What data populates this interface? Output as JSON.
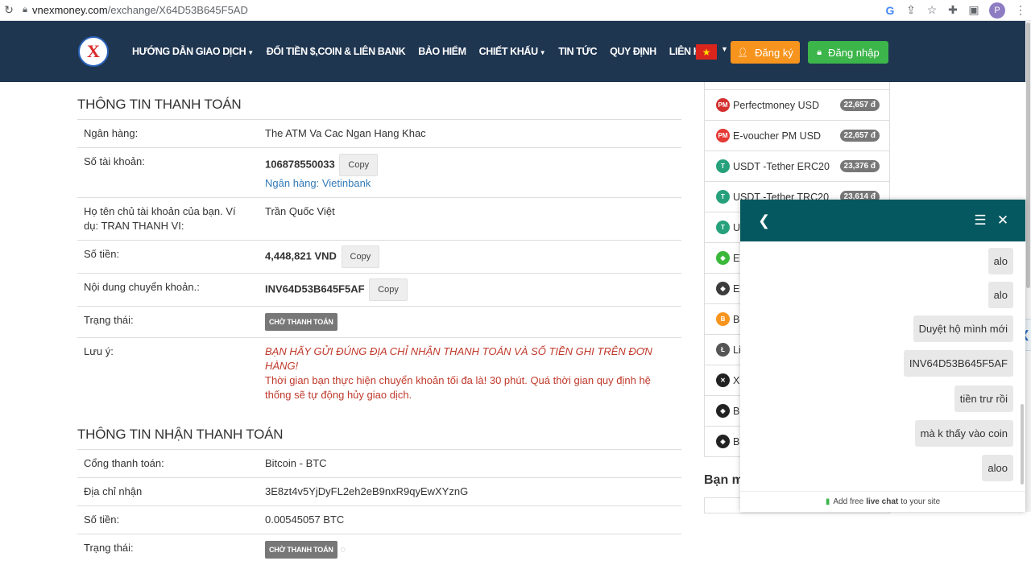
{
  "browser": {
    "url_host": "vnexmoney.com",
    "url_path": "/exchange/X64D53B645F5AD",
    "profile_initial": "P"
  },
  "nav": {
    "items": [
      {
        "label": "HƯỚNG DẪN GIAO DỊCH",
        "has_caret": true
      },
      {
        "label": "ĐỔI TIỀN $,COIN & LIÊN BANK",
        "has_caret": false
      },
      {
        "label": "BẢO HIỂM",
        "has_caret": false
      },
      {
        "label": "CHIẾT KHẤU",
        "has_caret": true
      },
      {
        "label": "TIN TỨC",
        "has_caret": false
      },
      {
        "label": "QUY ĐỊNH",
        "has_caret": false
      },
      {
        "label": "LIÊN HỆ",
        "has_caret": false
      }
    ],
    "register_label": "Đăng ký",
    "login_label": "Đăng nhập",
    "colors": {
      "navbar": "#1f3651",
      "register": "#f7941d",
      "login": "#3cb54a"
    }
  },
  "payment": {
    "title": "THÔNG TIN THANH TOÁN",
    "bank_label": "Ngân hàng:",
    "bank_value": "The ATM Va Cac Ngan Hang Khac",
    "account_label": "Số tài khoản:",
    "account_value": "106878550033",
    "copy_label": "Copy",
    "account_bank_link": "Ngân hàng: Vietinbank",
    "holder_label": "Họ tên chủ tài khoản của bạn. Ví dụ: TRAN THANH VI:",
    "holder_value": "Trần Quốc Việt",
    "amount_label": "Số tiền:",
    "amount_value": "4,448,821 VND",
    "content_label": "Nội dung chuyển khoản.:",
    "content_value": "INV64D53B645F5AF",
    "status_label": "Trạng thái:",
    "status_value": "CHỜ THANH TOÁN",
    "note_label": "Lưu ý:",
    "note_warning": "BẠN HÃY GỬI ĐÚNG ĐỊA CHỈ NHẬN THANH TOÁN VÀ SỐ TIỀN GHI TRÊN ĐƠN HÀNG!",
    "note_text": "Thời gian bạn thực hiện chuyển khoản tối đa là! 30 phút. Quá thời gian quy định hệ thống sẽ tự động hủy giao dịch."
  },
  "receive": {
    "title": "THÔNG TIN NHẬN THANH TOÁN",
    "gateway_label": "Cổng thanh toán:",
    "gateway_value": "Bitcoin - BTC",
    "address_label": "Địa chỉ nhận",
    "address_value": "3E8zt4v5YjDyFL2eh2eB9nxR9qyEwXYznG",
    "amount_label": "Số tiền:",
    "amount_value": "0.00545057 BTC",
    "status_label": "Trạng thái:",
    "status_value": "CHỜ THANH TOÁN"
  },
  "rates": [
    {
      "name": "Perfectmoney USD",
      "rate": "22,657 đ",
      "icon": "pm-icon",
      "color": "#d32f2f"
    },
    {
      "name": "E-voucher PM USD",
      "rate": "22,657 đ",
      "icon": "pm-voucher-icon",
      "color": "#e53935"
    },
    {
      "name": "USDT -Tether ERC20",
      "rate": "23,376 đ",
      "icon": "tether-icon",
      "color": "#26a17b"
    },
    {
      "name": "USDT -Tether TRC20",
      "rate": "23,614 đ",
      "icon": "tether-icon",
      "color": "#26a17b"
    },
    {
      "name": "US",
      "rate": "",
      "icon": "tether-icon",
      "color": "#26a17b"
    },
    {
      "name": "ET",
      "rate": "",
      "icon": "ethereum-classic-icon",
      "color": "#3ab83a"
    },
    {
      "name": "Et",
      "rate": "",
      "icon": "ethereum-icon",
      "color": "#3c3c3d"
    },
    {
      "name": "BC",
      "rate": "",
      "icon": "bitcoin-cash-icon",
      "color": "#f7941d"
    },
    {
      "name": "Li",
      "rate": "",
      "icon": "litecoin-icon",
      "color": "#555555"
    },
    {
      "name": "XI",
      "rate": "",
      "icon": "xrp-icon",
      "color": "#222222"
    },
    {
      "name": "BI",
      "rate": "",
      "icon": "bnb-icon",
      "color": "#222222"
    },
    {
      "name": "BU",
      "rate": "",
      "icon": "busd-icon",
      "color": "#222222"
    }
  ],
  "bank_heading": "Bạn m",
  "chat": {
    "messages": [
      "alo",
      "alo",
      "Duyệt hộ mình mới",
      "INV64D53B645F5AF",
      "tiền trư rồi",
      "mà k thấy vào coin",
      "aloo"
    ],
    "footer_pre": "Add free",
    "footer_bold": "live chat",
    "footer_post": "to your site",
    "header_color": "#05585f"
  }
}
